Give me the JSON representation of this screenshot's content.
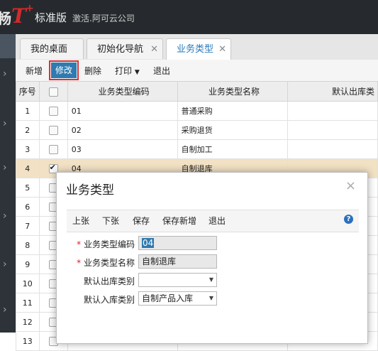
{
  "header": {
    "brand_partial": "畅",
    "brand_logo": "T",
    "edition": "标准版",
    "company": "激活.阿可云公司"
  },
  "tabs": [
    {
      "label": "我的桌面"
    },
    {
      "label": "初始化导航"
    },
    {
      "label": "业务类型"
    }
  ],
  "toolbar": {
    "new": "新增",
    "edit": "修改",
    "delete": "删除",
    "print": "打印",
    "exit": "退出"
  },
  "grid": {
    "headers": {
      "seq": "序号",
      "code": "业务类型编码",
      "name": "业务类型名称",
      "default_out": "默认出库类"
    },
    "rows": [
      {
        "seq": "1",
        "code": "01",
        "name": "普通采购",
        "checked": false
      },
      {
        "seq": "2",
        "code": "02",
        "name": "采购退货",
        "checked": false
      },
      {
        "seq": "3",
        "code": "03",
        "name": "自制加工",
        "checked": false
      },
      {
        "seq": "4",
        "code": "04",
        "name": "自制退库",
        "checked": true
      },
      {
        "seq": "5",
        "code": "",
        "name": "",
        "checked": false
      },
      {
        "seq": "6",
        "code": "",
        "name": "",
        "checked": false
      },
      {
        "seq": "7",
        "code": "",
        "name": "",
        "checked": false
      },
      {
        "seq": "8",
        "code": "",
        "name": "",
        "checked": false
      },
      {
        "seq": "9",
        "code": "",
        "name": "",
        "checked": false
      },
      {
        "seq": "10",
        "code": "",
        "name": "",
        "checked": false
      },
      {
        "seq": "11",
        "code": "",
        "name": "",
        "checked": false
      },
      {
        "seq": "12",
        "code": "",
        "name": "",
        "checked": false
      },
      {
        "seq": "13",
        "code": "",
        "name": "",
        "checked": false
      }
    ]
  },
  "dialog": {
    "title": "业务类型",
    "toolbar": {
      "prev": "上张",
      "next": "下张",
      "save": "保存",
      "save_new": "保存新增",
      "exit": "退出"
    },
    "fields": {
      "code_label": "业务类型编码",
      "code_value": "04",
      "name_label": "业务类型名称",
      "name_value": "自制退库",
      "out_label": "默认出库类别",
      "out_value": "",
      "in_label": "默认入库类别",
      "in_value": "自制产品入库"
    }
  },
  "colors": {
    "accent": "#2f7ab0",
    "topbar": "#262a2e",
    "selected_row": "#f2e1c4",
    "highlight_border": "#e03030"
  }
}
